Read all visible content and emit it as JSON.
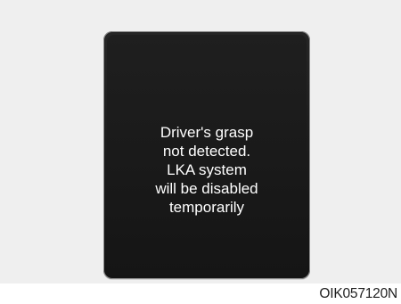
{
  "display": {
    "message_lines": [
      "Driver's grasp",
      "not detected.",
      "LKA system",
      "will be disabled",
      "temporarily"
    ]
  },
  "figure_code": "OIK057120N"
}
